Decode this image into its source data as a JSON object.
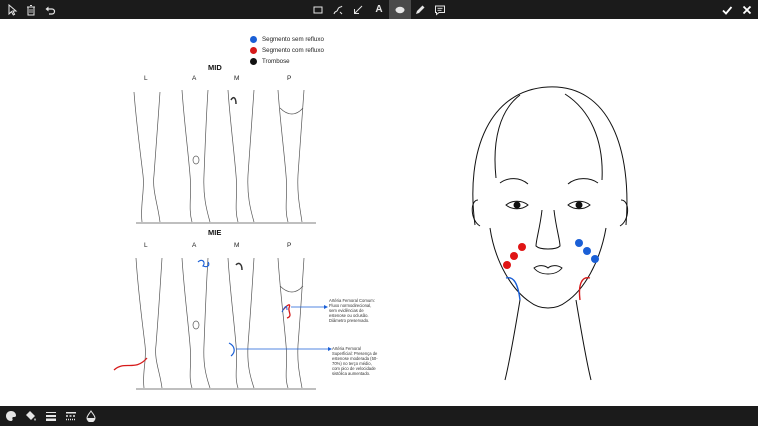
{
  "toolbar": {
    "left_tools": [
      "select-tool",
      "delete-tool",
      "undo-tool"
    ],
    "center_tools": [
      "rectangle-tool",
      "freehand-tool",
      "arrow-tool",
      "text-tool",
      "ellipse-tool",
      "pen-tool",
      "comment-tool"
    ],
    "text_tool_glyph": "A",
    "active_tool": "ellipse-tool",
    "right_tools": [
      "confirm-tool",
      "close-tool"
    ]
  },
  "bottom_toolbar": {
    "tools": [
      "palette-tool",
      "fill-tool",
      "line-weight-tool",
      "line-style-tool",
      "opacity-tool"
    ]
  },
  "legend": {
    "items": [
      {
        "label": "Segmento sem refluxo",
        "color": "#1a5fd6"
      },
      {
        "label": "Segmento com refluxo",
        "color": "#d61a1a"
      },
      {
        "label": "Trombose",
        "color": "#111111"
      }
    ]
  },
  "diagram": {
    "top_title": "MID",
    "bottom_title": "MIE",
    "view_labels": [
      "L",
      "A",
      "M",
      "P"
    ],
    "annotation_1": "Artéria Femoral Comum: Fluxo normodirecional, sem evidências de estenose ou oclusão. Diâmetro preservado.",
    "annotation_2": "Artéria Femoral Superficial: Presença de estenose moderada (50-70%) no terço médio, com pico de velocidade sistólica aumentado."
  },
  "face_markers": {
    "red_count": 3,
    "blue_count": 3,
    "red_color": "#e01515",
    "blue_color": "#1a5fd6"
  }
}
